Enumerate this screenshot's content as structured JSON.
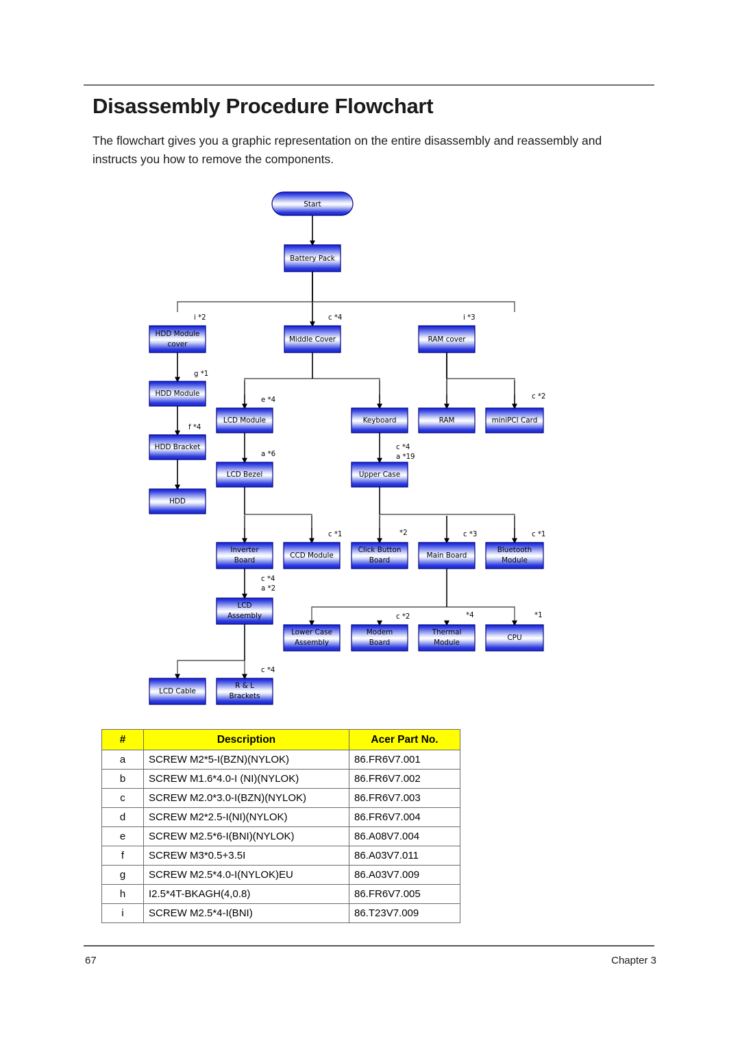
{
  "page": {
    "title": "Disassembly Procedure Flowchart",
    "intro": "The flowchart gives you a graphic representation on the entire disassembly and reassembly and instructs you how to remove the components.",
    "footer_page_number": "67",
    "footer_chapter": "Chapter 3"
  },
  "theme": {
    "node_fill_top": "#1f2fd8",
    "node_fill_mid": "#ffffff",
    "node_fill_bottom": "#2030d0",
    "node_border": "#000080",
    "edge_color": "#000000",
    "table_header_bg": "#ffff00",
    "table_border": "#6a6a6a"
  },
  "flowchart": {
    "type": "flowchart",
    "nodes": [
      {
        "id": "start",
        "label": [
          "Start"
        ],
        "shape": "pill"
      },
      {
        "id": "battery",
        "label": [
          "Battery Pack"
        ],
        "shape": "rect"
      },
      {
        "id": "hdd_mod_cover",
        "label": [
          "HDD Module",
          "cover"
        ],
        "shape": "rect"
      },
      {
        "id": "middle_cover",
        "label": [
          "Middle Cover"
        ],
        "shape": "rect"
      },
      {
        "id": "ram_cover",
        "label": [
          "RAM cover"
        ],
        "shape": "rect"
      },
      {
        "id": "hdd_module",
        "label": [
          "HDD Module"
        ],
        "shape": "rect"
      },
      {
        "id": "lcd_module",
        "label": [
          "LCD Module"
        ],
        "shape": "rect"
      },
      {
        "id": "keyboard",
        "label": [
          "Keyboard"
        ],
        "shape": "rect"
      },
      {
        "id": "ram",
        "label": [
          "RAM"
        ],
        "shape": "rect"
      },
      {
        "id": "minipci",
        "label": [
          "miniPCI Card"
        ],
        "shape": "rect"
      },
      {
        "id": "hdd_bracket",
        "label": [
          "HDD Bracket"
        ],
        "shape": "rect"
      },
      {
        "id": "lcd_bezel",
        "label": [
          "LCD Bezel"
        ],
        "shape": "rect"
      },
      {
        "id": "upper_case",
        "label": [
          "Upper Case"
        ],
        "shape": "rect"
      },
      {
        "id": "hdd",
        "label": [
          "HDD"
        ],
        "shape": "rect"
      },
      {
        "id": "inverter",
        "label": [
          "Inverter",
          "Board"
        ],
        "shape": "rect"
      },
      {
        "id": "ccd_module",
        "label": [
          "CCD Module"
        ],
        "shape": "rect"
      },
      {
        "id": "click_button",
        "label": [
          "Click Button",
          "Board"
        ],
        "shape": "rect"
      },
      {
        "id": "main_board",
        "label": [
          "Main Board"
        ],
        "shape": "rect"
      },
      {
        "id": "bluetooth",
        "label": [
          "Bluetooth",
          "Module"
        ],
        "shape": "rect"
      },
      {
        "id": "lcd_assembly",
        "label": [
          "LCD",
          "Assembly"
        ],
        "shape": "rect"
      },
      {
        "id": "lower_case",
        "label": [
          "Lower Case",
          "Assembly"
        ],
        "shape": "rect"
      },
      {
        "id": "modem_board",
        "label": [
          "Modem",
          "Board"
        ],
        "shape": "rect"
      },
      {
        "id": "thermal",
        "label": [
          "Thermal",
          "Module"
        ],
        "shape": "rect"
      },
      {
        "id": "cpu",
        "label": [
          "CPU"
        ],
        "shape": "rect"
      },
      {
        "id": "lcd_cable",
        "label": [
          "LCD Cable"
        ],
        "shape": "rect"
      },
      {
        "id": "rl_brackets",
        "label": [
          "R & L",
          "Brackets"
        ],
        "shape": "rect"
      }
    ],
    "edge_labels": [
      {
        "for": "hdd_mod_cover",
        "text": "i *2"
      },
      {
        "for": "middle_cover",
        "text": "c *4"
      },
      {
        "for": "ram_cover",
        "text": "i *3"
      },
      {
        "for": "hdd_module",
        "text": "g *1"
      },
      {
        "for": "lcd_module",
        "text": "e *4"
      },
      {
        "for": "minipci",
        "text": "c *2"
      },
      {
        "for": "hdd_bracket",
        "text": "f *4"
      },
      {
        "for": "lcd_bezel",
        "text": "a *6"
      },
      {
        "for": "upper_case",
        "text": "c *4"
      },
      {
        "for": "upper_case_2",
        "text": "a *19"
      },
      {
        "for": "ccd_module",
        "text": "c *1"
      },
      {
        "for": "click_button",
        "text": "*2"
      },
      {
        "for": "main_board",
        "text": "c *3"
      },
      {
        "for": "bluetooth",
        "text": "c *1"
      },
      {
        "for": "lcd_assembly",
        "text": "c *4"
      },
      {
        "for": "lcd_assembly_2",
        "text": "a *2"
      },
      {
        "for": "modem_board",
        "text": "c *2"
      },
      {
        "for": "thermal",
        "text": "*4"
      },
      {
        "for": "cpu",
        "text": "*1"
      },
      {
        "for": "rl_brackets",
        "text": "c *4"
      }
    ],
    "connections": [
      [
        "start",
        "battery"
      ],
      [
        "battery",
        "hdd_mod_cover"
      ],
      [
        "battery",
        "middle_cover"
      ],
      [
        "battery",
        "ram_cover"
      ],
      [
        "hdd_mod_cover",
        "hdd_module"
      ],
      [
        "hdd_module",
        "hdd_bracket"
      ],
      [
        "hdd_bracket",
        "hdd"
      ],
      [
        "middle_cover",
        "lcd_module"
      ],
      [
        "middle_cover",
        "keyboard"
      ],
      [
        "ram_cover",
        "ram"
      ],
      [
        "ram_cover",
        "minipci"
      ],
      [
        "lcd_module",
        "lcd_bezel"
      ],
      [
        "keyboard",
        "upper_case"
      ],
      [
        "lcd_bezel",
        "inverter"
      ],
      [
        "lcd_bezel",
        "ccd_module"
      ],
      [
        "upper_case",
        "click_button"
      ],
      [
        "upper_case",
        "main_board"
      ],
      [
        "upper_case",
        "bluetooth"
      ],
      [
        "inverter",
        "lcd_assembly"
      ],
      [
        "main_board",
        "lower_case"
      ],
      [
        "main_board",
        "modem_board"
      ],
      [
        "main_board",
        "thermal"
      ],
      [
        "main_board",
        "cpu"
      ],
      [
        "lcd_assembly",
        "lcd_cable"
      ],
      [
        "lcd_assembly",
        "rl_brackets"
      ]
    ]
  },
  "parts_table": {
    "headers": [
      "#",
      "Description",
      "Acer Part No."
    ],
    "rows": [
      {
        "num": "a",
        "description": "SCREW M2*5-I(BZN)(NYLOK)",
        "part_no": "86.FR6V7.001"
      },
      {
        "num": "b",
        "description": "SCREW M1.6*4.0-I (NI)(NYLOK)",
        "part_no": "86.FR6V7.002"
      },
      {
        "num": "c",
        "description": "SCREW M2.0*3.0-I(BZN)(NYLOK)",
        "part_no": "86.FR6V7.003"
      },
      {
        "num": "d",
        "description": "SCREW M2*2.5-I(NI)(NYLOK)",
        "part_no": "86.FR6V7.004"
      },
      {
        "num": "e",
        "description": "SCREW M2.5*6-I(BNI)(NYLOK)",
        "part_no": "86.A08V7.004"
      },
      {
        "num": "f",
        "description": "SCREW M3*0.5+3.5I",
        "part_no": "86.A03V7.011"
      },
      {
        "num": "g",
        "description": "SCREW M2.5*4.0-I(NYLOK)EU",
        "part_no": "86.A03V7.009"
      },
      {
        "num": "h",
        "description": "I2.5*4T-BKAGH(4,0.8)",
        "part_no": "86.FR6V7.005"
      },
      {
        "num": "i",
        "description": "SCREW M2.5*4-I(BNI)",
        "part_no": "86.T23V7.009"
      }
    ]
  }
}
